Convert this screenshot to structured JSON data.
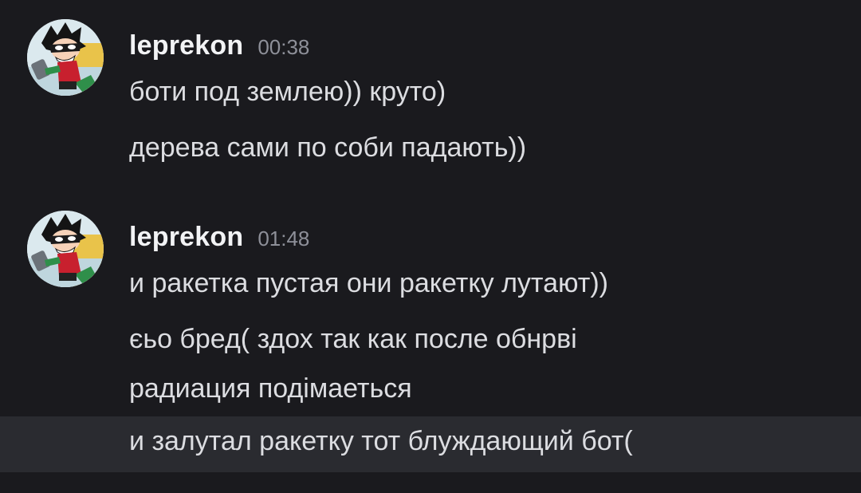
{
  "groups": [
    {
      "username": "leprekon",
      "timestamp": "00:38",
      "avatar_icon": "robin-avatar",
      "lines": [
        "боти под землею)) круто)",
        "дерева сами по соби падають))"
      ]
    },
    {
      "username": "leprekon",
      "timestamp": "01:48",
      "avatar_icon": "robin-avatar",
      "lines": [
        "и ракетка пустая они ракетку лутают))",
        "єьо бред( здох так как после обнрві",
        "радиация подімаеться",
        "и залутал ракетку тот блуждающий бот("
      ]
    }
  ],
  "colors": {
    "background": "#1a1a1e",
    "highlight_row": "#2a2b30",
    "username": "#f2f3f5",
    "message_text": "#dcdde1",
    "timestamp": "#8e9099"
  }
}
